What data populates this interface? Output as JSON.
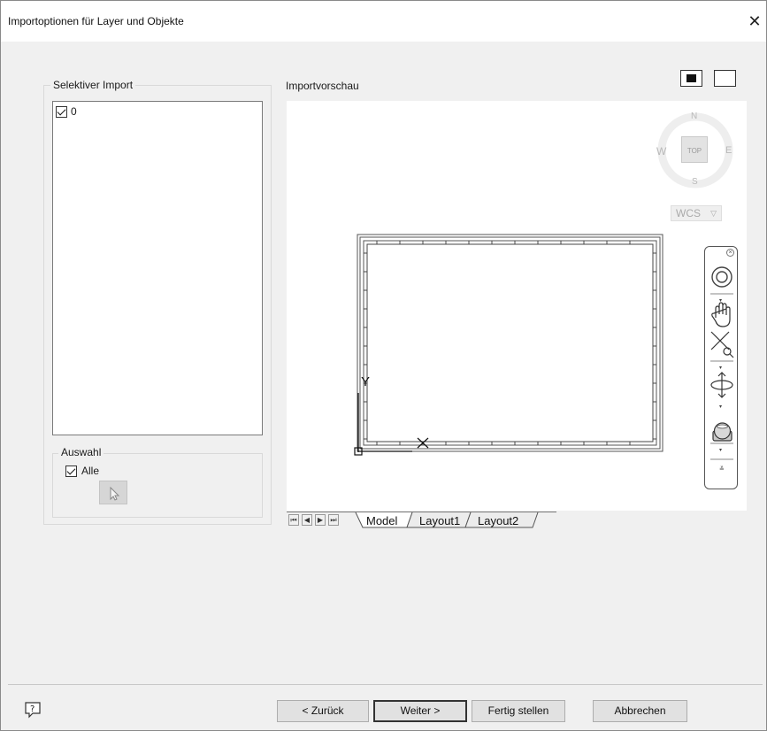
{
  "window": {
    "title": "Importoptionen für Layer und Objekte",
    "close_glyph": "✕"
  },
  "selective_import": {
    "label": "Selektiver Import",
    "layers": [
      {
        "name": "0",
        "checked": true
      }
    ]
  },
  "selection": {
    "label": "Auswahl",
    "all_label": "Alle",
    "all_checked": true
  },
  "preview": {
    "label": "Importvorschau",
    "viewcube": {
      "north": "N",
      "south": "S",
      "east": "E",
      "west": "W",
      "face": "TOP",
      "wcs": "WCS"
    },
    "ucs": {
      "y": "Y",
      "x": "X"
    },
    "tabs": [
      "Model",
      "Layout1",
      "Layout2"
    ],
    "nav_glyphs": [
      "⏮",
      "◀",
      "▶",
      "⏭"
    ],
    "navbar_icons": [
      "close-icon",
      "steering-wheel-icon",
      "pan-hand-icon",
      "zoom-extents-icon",
      "orbit-icon",
      "showmotion-icon",
      "customize-icon"
    ]
  },
  "buttons": {
    "back": "< Zurück",
    "next": "Weiter >",
    "finish": "Fertig stellen",
    "cancel": "Abbrechen"
  }
}
